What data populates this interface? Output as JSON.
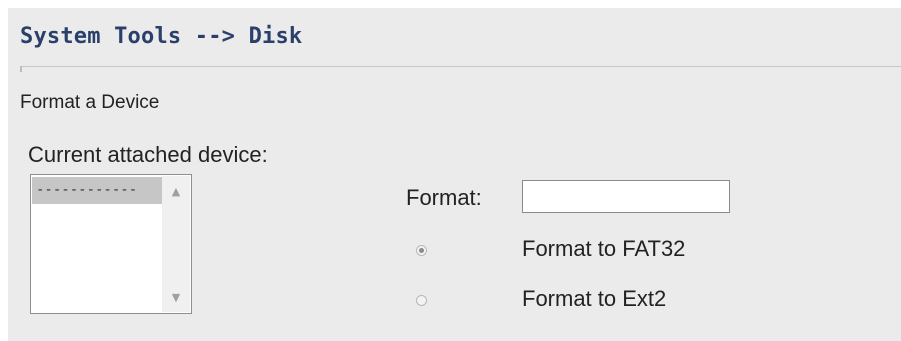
{
  "header": {
    "title": "System Tools --> Disk"
  },
  "section": {
    "title": "Format a Device"
  },
  "device_list": {
    "label": "Current attached device:",
    "options": [
      "------------"
    ],
    "selected": "------------"
  },
  "format": {
    "label": "Format:",
    "value": "",
    "options": [
      {
        "label": "Format to FAT32",
        "checked": true
      },
      {
        "label": "Format to Ext2",
        "checked": false
      }
    ]
  },
  "icons": {
    "scroll_up": "scroll-up-arrow",
    "scroll_down": "scroll-down-arrow"
  },
  "colors": {
    "title": "#2b3f6b",
    "panel_bg": "#ebebeb"
  }
}
